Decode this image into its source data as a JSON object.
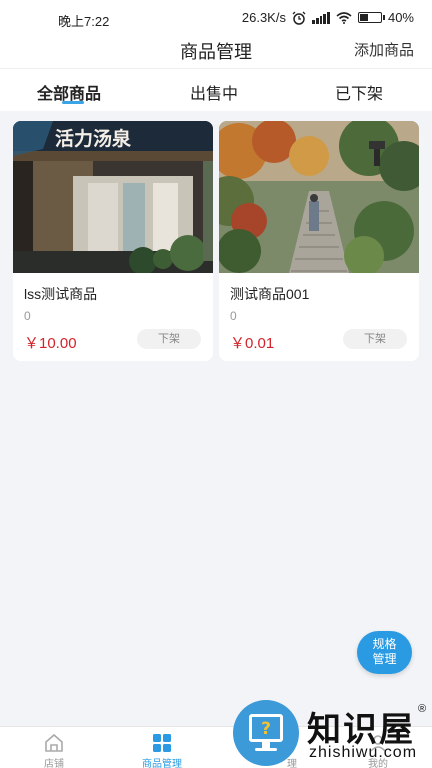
{
  "status_bar": {
    "time": "晚上7:22",
    "network_speed": "26.3K/s",
    "battery": "40%",
    "battery_level": 0.4
  },
  "header": {
    "title": "商品管理",
    "add_product": "添加商品"
  },
  "tabs": [
    {
      "label": "全部商品",
      "active": true
    },
    {
      "label": "出售中",
      "active": false
    },
    {
      "label": "已下架",
      "active": false
    }
  ],
  "products": [
    {
      "name": "lss测试商品",
      "count": "0",
      "price": "￥10.00",
      "action": "下架",
      "image_sign": "活力汤泉"
    },
    {
      "name": "测试商品001",
      "count": "0",
      "price": "￥0.01",
      "action": "下架"
    }
  ],
  "spec_button": {
    "line1": "规格",
    "line2": "管理"
  },
  "bottom_nav": [
    {
      "label": "店铺",
      "icon": "store-icon"
    },
    {
      "label": "商品管理",
      "icon": "grid-icon"
    },
    {
      "label": "理",
      "icon": "order-icon"
    },
    {
      "label": "我的",
      "icon": "user-icon"
    }
  ],
  "watermark": {
    "text": "知识屋",
    "domain": "zhishiwu.com",
    "reg": "®"
  },
  "colors": {
    "accent": "#2a9be2",
    "price": "#d2232a",
    "background": "#f3f4f7"
  }
}
